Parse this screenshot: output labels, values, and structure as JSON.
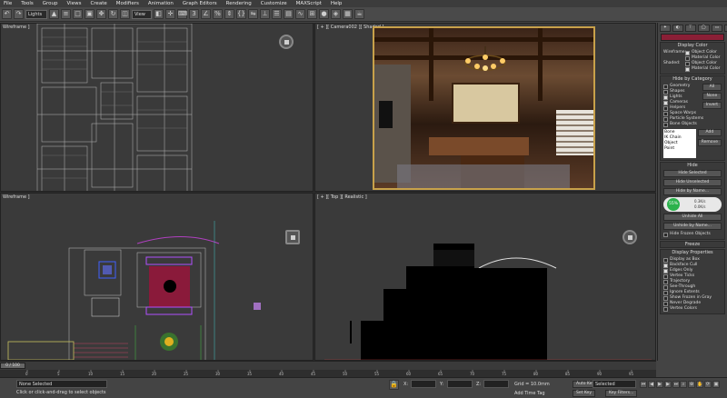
{
  "menu": [
    "File",
    "Tools",
    "Group",
    "Views",
    "Create",
    "Modifiers",
    "Animation",
    "Graph Editors",
    "Rendering",
    "Customize",
    "MAXScript",
    "Help"
  ],
  "toolbar": {
    "selection_filter": "Lights",
    "ref_coord": "View"
  },
  "viewports": {
    "top_left": "Wireframe ]",
    "top_right": "[ + ][ Camera002 ][ Shaded ]",
    "bottom_left": "Wireframe ]",
    "bottom_right": "[ + ][ Top ][ Realistic ]"
  },
  "panel": {
    "display_color": {
      "title": "Display Color",
      "wireframe_label": "Wireframe:",
      "shaded_label": "Shaded:",
      "object_color": "Object Color",
      "material_color": "Material Color"
    },
    "hide_by_category": {
      "title": "Hide by Category",
      "items": [
        "Geometry",
        "Shapes",
        "Lights",
        "Cameras",
        "Helpers",
        "Space Warps",
        "Particle Systems",
        "Bone Objects"
      ],
      "checked": [
        false,
        false,
        true,
        true,
        false,
        false,
        false,
        false
      ],
      "all": "All",
      "none": "None",
      "invert": "Invert",
      "list": [
        "Bone",
        "IK Chain Object",
        "Point"
      ],
      "add": "Add",
      "remove": "Remove"
    },
    "hide": {
      "title": "Hide",
      "hide_selected": "Hide Selected",
      "hide_unselected": "Hide Unselected",
      "hide_by_name": "Hide by Name...",
      "unhide_all": "Unhide All",
      "unhide_by_name": "Unhide by Name...",
      "hide_frozen": "Hide Frozen Objects"
    },
    "widget": {
      "percent": "55%",
      "up": "0.3K/s",
      "down": "0.0K/s"
    },
    "freeze": {
      "title": "Freeze"
    },
    "display_properties": {
      "title": "Display Properties",
      "items": [
        "Display as Box",
        "Backface Cull",
        "Edges Only",
        "Vertex Ticks",
        "Trajectory",
        "See-Through",
        "Ignore Extents",
        "Show Frozen in Gray",
        "Never Degrade",
        "Vertex Colors"
      ]
    }
  },
  "timeline": {
    "frame": "0 / 100",
    "ticks": [
      "0",
      "5",
      "10",
      "15",
      "20",
      "25",
      "30",
      "35",
      "40",
      "45",
      "50",
      "55",
      "60",
      "65",
      "70",
      "75",
      "80",
      "85",
      "90",
      "95"
    ]
  },
  "status": {
    "selected": "None Selected",
    "prompt": "Click or click-and-drag to select objects",
    "grid": "Grid = 10.0mm",
    "add_time_tag": "Add Time Tag",
    "auto_key": "Auto Key",
    "set_key": "Set Key",
    "selected_dd": "Selected",
    "key_filters": "Key Filters...",
    "x": "X:",
    "y": "Y:",
    "z": "Z:"
  }
}
